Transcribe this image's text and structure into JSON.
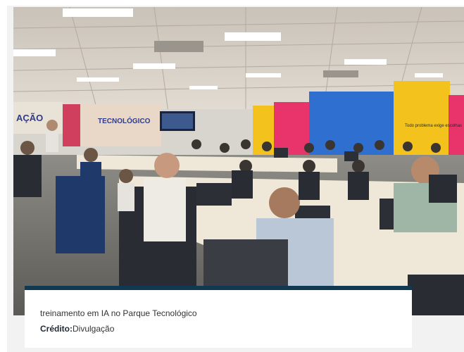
{
  "photo": {
    "banner_left_text": "AÇÃO",
    "banner_center_text": "TECNOLÓGICO",
    "banner_right_text": "Todo problema exige escolhas"
  },
  "caption": {
    "text": "treinamento em IA no Parque Tecnológico",
    "credit_label": "Crédito:",
    "credit_value": "Divulgação"
  },
  "colors": {
    "caption_bar": "#113a52",
    "banner_pink": "#e8336b",
    "banner_blue": "#2f6fd0",
    "banner_yellow": "#f3c21c"
  }
}
